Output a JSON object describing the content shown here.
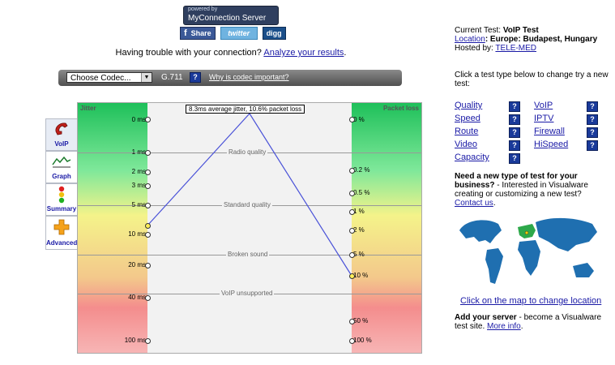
{
  "header": {
    "powered_small": "powered by",
    "powered_big": "MyConnection Server",
    "share": {
      "facebook": "Share",
      "twitter": "twitter",
      "digg": "digg"
    },
    "trouble_text": "Having trouble with your connection?",
    "trouble_link": "Analyze your results",
    "trouble_end": "."
  },
  "codec": {
    "select_label": "Choose Codec...",
    "value": "G.711",
    "help": "?",
    "link": "Why is codec important?"
  },
  "tabs": [
    {
      "label": "VoIP",
      "icon": "phone-icon"
    },
    {
      "label": "Graph",
      "icon": "graph-icon"
    },
    {
      "label": "Summary",
      "icon": "traffic-light-icon"
    },
    {
      "label": "Advanced",
      "icon": "plus-icon"
    }
  ],
  "chart": {
    "jitter_header": "Jitter",
    "packet_header": "Packet loss",
    "summary": "8.3ms average jitter, 10.6% packet loss",
    "zones": [
      "Radio quality",
      "Standard quality",
      "Broken sound",
      "VoIP unsupported"
    ],
    "jitter_ticks": [
      "0 ms",
      "1 ms",
      "2 ms",
      "3 ms",
      "5 ms",
      "10 ms",
      "20 ms",
      "40 ms",
      "100 ms"
    ],
    "packet_ticks": [
      "0 %",
      "0.2 %",
      "0.5 %",
      "1 %",
      "2 %",
      "5 %",
      "10 %",
      "50 %",
      "100 %"
    ]
  },
  "chart_data": {
    "type": "line",
    "title": "8.3ms average jitter, 10.6% packet loss",
    "xlabel": "",
    "ylabel": "",
    "series": [
      {
        "name": "Jitter",
        "unit": "ms",
        "value": 8.3
      },
      {
        "name": "Packet loss",
        "unit": "%",
        "value": 10.6
      }
    ]
  },
  "right": {
    "current_label": "Current Test:",
    "current_value": "VoIP Test",
    "location_label": "Location",
    "location_value": ": Europe: Budapest, Hungary",
    "hosted_label": "Hosted by:",
    "hosted_value": "TELE-MED",
    "click_text": "Click a test type below to change try a new test:",
    "tests": [
      "Quality",
      "VoIP",
      "Speed",
      "IPTV",
      "Route",
      "Firewall",
      "Video",
      "HiSpeed",
      "Capacity"
    ],
    "need_bold": "Need a new type of test for your business?",
    "need_rest": " - Interested in Visualware creating or customizing a new test?",
    "contact": "Contact us",
    "contact_end": ".",
    "map_link": "Click on the map to change location",
    "add_bold": "Add your server",
    "add_rest": " - become a Visualware test site.",
    "more_info": "More info",
    "more_end": "."
  }
}
